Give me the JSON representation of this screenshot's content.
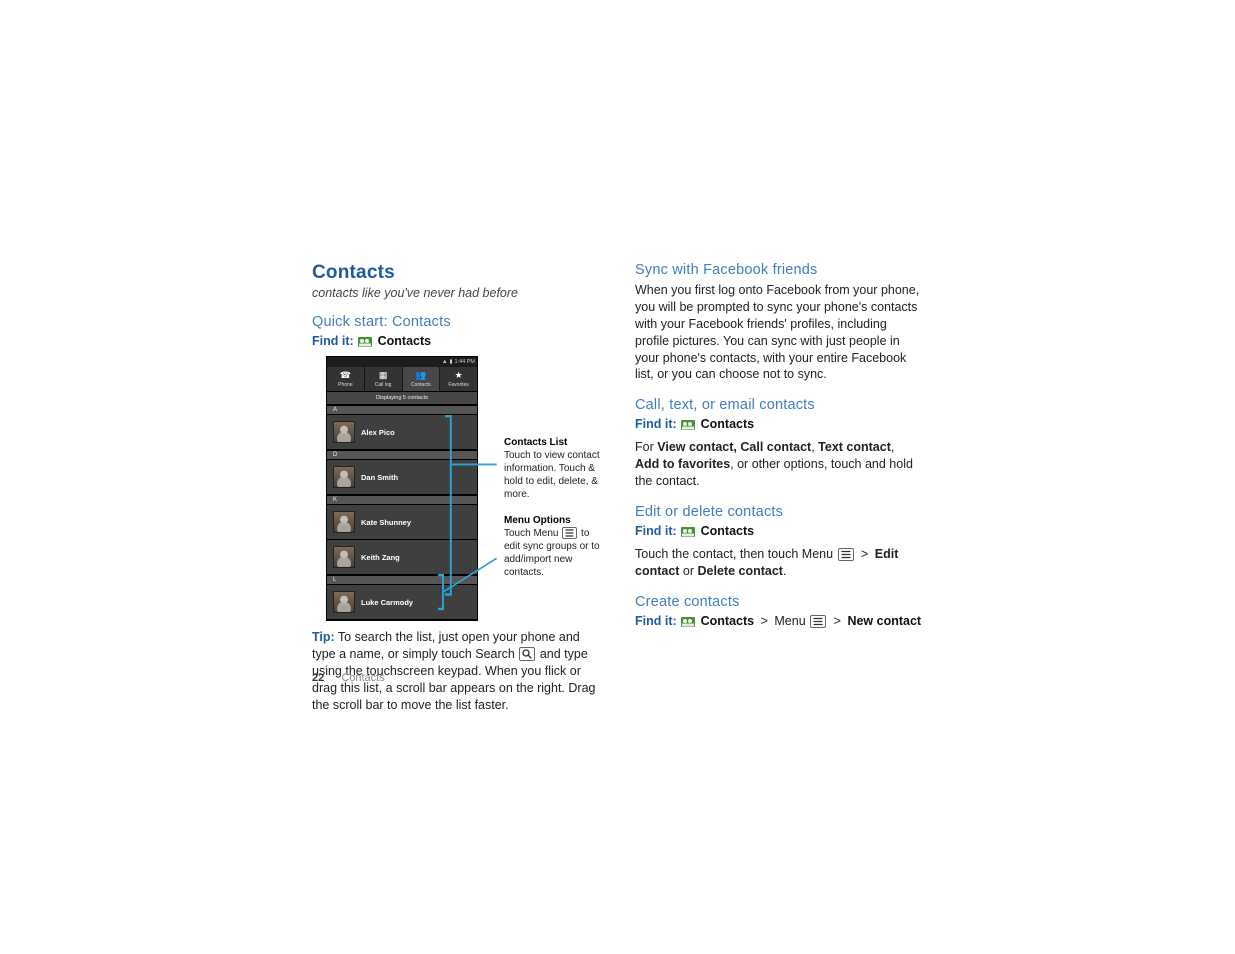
{
  "page_title_h1": "Contacts",
  "tagline": "contacts like you've never had before",
  "footer": {
    "page_number": "22",
    "section": "Contacts"
  },
  "left": {
    "h2_quickstart": "Quick start: Contacts",
    "findit_label": "Find it:",
    "findit_dest": "Contacts",
    "phone": {
      "status_left": "",
      "status_time": "1:44 PM",
      "tabs": [
        {
          "glyph": "☎",
          "label": "Phone"
        },
        {
          "glyph": "▦",
          "label": "Call log"
        },
        {
          "glyph": "👥",
          "label": "Contacts",
          "active": true
        },
        {
          "glyph": "★",
          "label": "Favorites"
        }
      ],
      "displaying": "Displaying 5 contacts",
      "sections": [
        {
          "letter": "A",
          "rows": [
            "Alex Pico"
          ]
        },
        {
          "letter": "D",
          "rows": [
            "Dan Smith"
          ]
        },
        {
          "letter": "K",
          "rows": [
            "Kate Shunney",
            "Keith Zang"
          ]
        },
        {
          "letter": "L",
          "rows": [
            "Luke Carmody"
          ]
        }
      ]
    },
    "callout_list": {
      "title": "Contacts  List",
      "body": "Touch to view contact information. Touch & hold to edit, delete, & more."
    },
    "callout_menu": {
      "title": "Menu Options",
      "body_pre": "Touch Menu ",
      "body_post": " to edit sync groups or to add/import new contacts."
    },
    "tip_label": "Tip:",
    "tip_pre": " To search the list, just open your phone and type a name, or simply touch Search ",
    "tip_post": " and type using the touchscreen keypad. When you flick or drag this list, a scroll bar appears on the right. Drag the scroll bar to move the list faster."
  },
  "right": {
    "h2_sync": "Sync with Facebook friends",
    "sync_body": "When you first log onto Facebook from your phone, you will be prompted to sync your phone's contacts with your Facebook friends' profiles, including profile pictures. You can sync with just people in your phone's contacts, with your entire Facebook list, or you can choose not to sync.",
    "h2_call": "Call, text, or email contacts",
    "call_findit_label": "Find it:",
    "call_findit_dest": "Contacts",
    "call_for": "For ",
    "call_b1": "View contact, Call contact",
    "call_sep1": ", ",
    "call_b2": "Text contact",
    "call_sep2": ", ",
    "call_b3": "Add to favorites",
    "call_tail": ", or other options, touch and hold the contact.",
    "h2_edit": "Edit or delete contacts",
    "edit_findit_label": "Find it:",
    "edit_findit_dest": "Contacts",
    "edit_pre": "Touch the contact, then touch Menu ",
    "edit_mid": " > ",
    "edit_b1": "Edit contact",
    "edit_or": " or ",
    "edit_b2": "Delete contact",
    "edit_end": ".",
    "h2_create": "Create contacts",
    "create_findit_label": "Find it:",
    "create_dest1": "Contacts",
    "create_menu_word": "Menu",
    "create_dest2": "New contact"
  }
}
